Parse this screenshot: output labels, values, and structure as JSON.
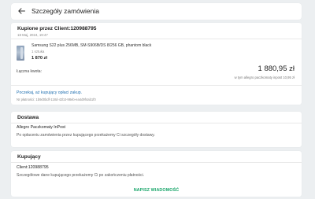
{
  "header": {
    "title": "Szczegóły zamówienia",
    "back_icon": "arrow-left-icon"
  },
  "order": {
    "title": "Kupione przez Client:120988795",
    "date": "18 Maj, 2024, 19:47",
    "product": {
      "name": "Samsung S22 plus 256MB, SM-S906B/DS 8/256 GB, phantom black",
      "quantity": "1 sztuka",
      "price": "1 870 zł"
    },
    "total_label": "Łączna kwota:",
    "total_value": "1 880,95 zł",
    "total_note": "w tym allegro paczkomaty inpost 10,95 zł",
    "wait_link": "Poczekaj, aż kupujący opłaci zakup.",
    "payment_number": "Nr płatności: 1b9d0bdf-118d-42b3-98eb-ea4d9f4ab1f0"
  },
  "delivery": {
    "title": "Dostawa",
    "method": "Allegro Paczkomaty InPost",
    "info": "Po opłaceniu zamówienia przez kupującego przekażemy Ci szczegóły dostawy."
  },
  "buyer": {
    "title": "Kupujący",
    "name": "Client:120988795",
    "info": "Szczegółowe dane kupującego przekażemy Ci po zakończeniu płatności.",
    "message_button": "NAPISZ WIADOMOŚĆ"
  },
  "colors": {
    "background": "#eceff1",
    "link": "#1f6fb0",
    "accent_green": "#1aa66b"
  }
}
